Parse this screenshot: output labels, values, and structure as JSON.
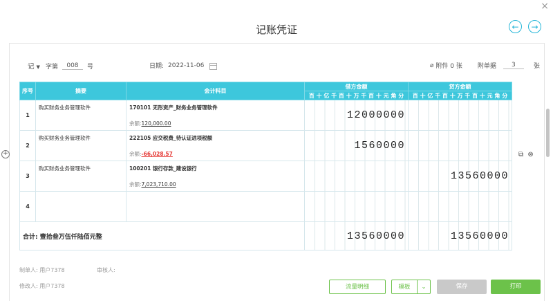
{
  "window": {
    "title": "记账凭证",
    "close_glyph": "×",
    "prev_glyph": "←",
    "next_glyph": "→"
  },
  "meta": {
    "type_label": "记",
    "zi_label": "字第",
    "number": "008",
    "hao_label": "号",
    "date_label": "日期:",
    "date_value": "2022-11-06",
    "attach_label": "附件 0 张",
    "doc_label": "附单据",
    "doc_count": "3",
    "zhang_label": "张"
  },
  "table": {
    "headers": {
      "seq": "序号",
      "summary": "摘要",
      "account": "会计科目",
      "debit": "借方金额",
      "credit": "贷方金额"
    },
    "units": [
      "百",
      "十",
      "亿",
      "千",
      "百",
      "十",
      "万",
      "千",
      "百",
      "十",
      "元",
      "角",
      "分"
    ],
    "rows": [
      {
        "seq": "1",
        "summary": "购买财务业务管理软件",
        "account": "170101 无形资产_财务业务管理软件",
        "balance_label": "余额:",
        "balance": "120,000.00",
        "debit": "12000000",
        "credit": ""
      },
      {
        "seq": "2",
        "summary": "购买财务业务管理软件",
        "account": "222105 应交税费_待认证进项税额",
        "balance_label": "余额:",
        "balance": "-66,028.57",
        "debit": "1560000",
        "credit": ""
      },
      {
        "seq": "3",
        "summary": "购买财务业务管理软件",
        "account": "100201 银行存款_建设银行",
        "balance_label": "余额:",
        "balance": "7,023,710.00",
        "debit": "",
        "credit": "13560000"
      },
      {
        "seq": "4",
        "summary": "",
        "account": "",
        "balance_label": "",
        "balance": "",
        "debit": "",
        "credit": ""
      }
    ],
    "total": {
      "label": "合计:  壹拾叁万伍仟陆佰元整",
      "debit": "13560000",
      "credit": "13560000"
    }
  },
  "footer": {
    "maker": "制单人: 用户7378",
    "auditor": "审核人:",
    "modifier": "修改人: 用户7378",
    "buttons": {
      "flow": "流量明细",
      "template": "模板",
      "save": "保存",
      "print": "打印"
    }
  },
  "colors": {
    "header": "#3dc7dc",
    "accent": "#25b6d8",
    "green": "#6cc24a",
    "negative": "#e53935"
  }
}
